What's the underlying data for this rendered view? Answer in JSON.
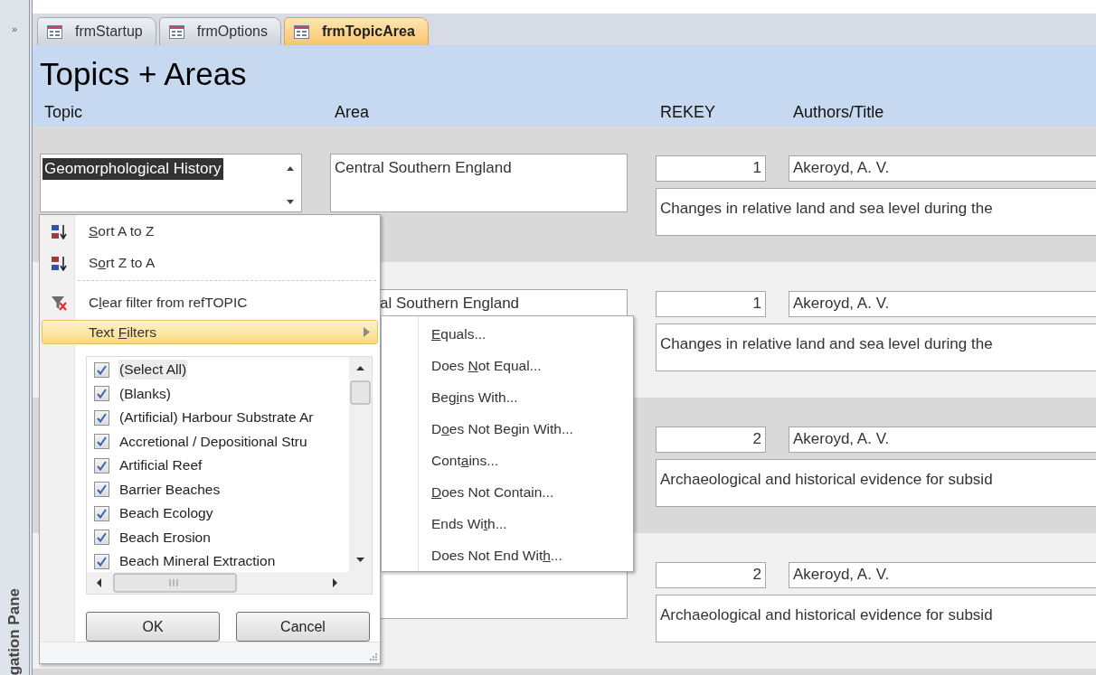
{
  "nav_pane": {
    "expand_glyph": "»",
    "label": "gation Pane"
  },
  "tabs": [
    {
      "label": "frmStartup",
      "selected": false
    },
    {
      "label": "frmOptions",
      "selected": false
    },
    {
      "label": "frmTopicArea",
      "selected": true
    }
  ],
  "form": {
    "title": "Topics + Areas",
    "columns": [
      "Topic",
      "Area",
      "REKEY",
      "Authors/Title"
    ],
    "records": [
      {
        "area_shown": true,
        "area_clipped": false,
        "topic": {
          "value": "Geomorphological History",
          "selected": true
        },
        "area": "Central Southern England",
        "rekey": "1",
        "author": "Akeroyd, A. V.",
        "title": "Changes in relative land and sea level during the"
      },
      {
        "area_shown": true,
        "area_clipped": true,
        "area": "al Southern England",
        "rekey": "1",
        "author": "Akeroyd, A. V.",
        "title": "Changes in relative land and sea level during the"
      },
      {
        "area_shown": false,
        "rekey": "2",
        "author": "Akeroyd, A. V.",
        "title": "Archaeological and historical evidence for subsid"
      },
      {
        "area_shown": true,
        "area_clipped": true,
        "rekey": "2",
        "author": "Akeroyd, A. V.",
        "title": "Archaeological and historical evidence for subsid"
      }
    ]
  },
  "filter_menu": {
    "items": [
      {
        "kind": "ascending",
        "label": {
          "key": "S",
          "after": "ort A to Z"
        },
        "selected": false
      },
      {
        "kind": "descending",
        "label": {
          "before": "S",
          "key": "o",
          "after": "rt Z to A"
        },
        "selected": false
      },
      {
        "kind": "separator"
      },
      {
        "kind": "clearfilter",
        "label": {
          "before": "C",
          "key": "l",
          "after": "ear filter from refTOPIC"
        },
        "selected": false
      },
      {
        "kind": "submenu",
        "label": {
          "before": "Text ",
          "key": "F",
          "after": "ilters"
        },
        "selected": true
      }
    ],
    "values": [
      {
        "label": "(Select All)",
        "checked": true,
        "selected": true
      },
      {
        "label": "(Blanks)",
        "checked": true,
        "selected": false
      },
      {
        "label": "(Artificial) Harbour Substrate Ar",
        "checked": true,
        "selected": false
      },
      {
        "label": "Accretional / Depositional Stru",
        "checked": true,
        "selected": false
      },
      {
        "label": "Artificial Reef",
        "checked": true,
        "selected": false
      },
      {
        "label": "Barrier Beaches",
        "checked": true,
        "selected": false
      },
      {
        "label": "Beach Ecology",
        "checked": true,
        "selected": false
      },
      {
        "label": "Beach Erosion",
        "checked": true,
        "selected": false
      },
      {
        "label": "Beach Mineral Extraction",
        "checked": true,
        "selected": false
      }
    ],
    "buttons": [
      "OK",
      "Cancel"
    ]
  },
  "text_filters_submenu": [
    {
      "key": "E",
      "after": "quals..."
    },
    {
      "before": "Does ",
      "key": "N",
      "after": "ot Equal..."
    },
    {
      "before": "Beg",
      "key": "i",
      "after": "ns With..."
    },
    {
      "before": "D",
      "key": "o",
      "after": "es Not Begin With..."
    },
    {
      "before": "Cont",
      "key": "a",
      "after": "ins..."
    },
    {
      "key": "D",
      "after": "oes Not Contain..."
    },
    {
      "before": "Ends Wi",
      "key": "t",
      "after": "h..."
    },
    {
      "before": "Does Not End Wit",
      "key": "h",
      "after": "..."
    }
  ]
}
